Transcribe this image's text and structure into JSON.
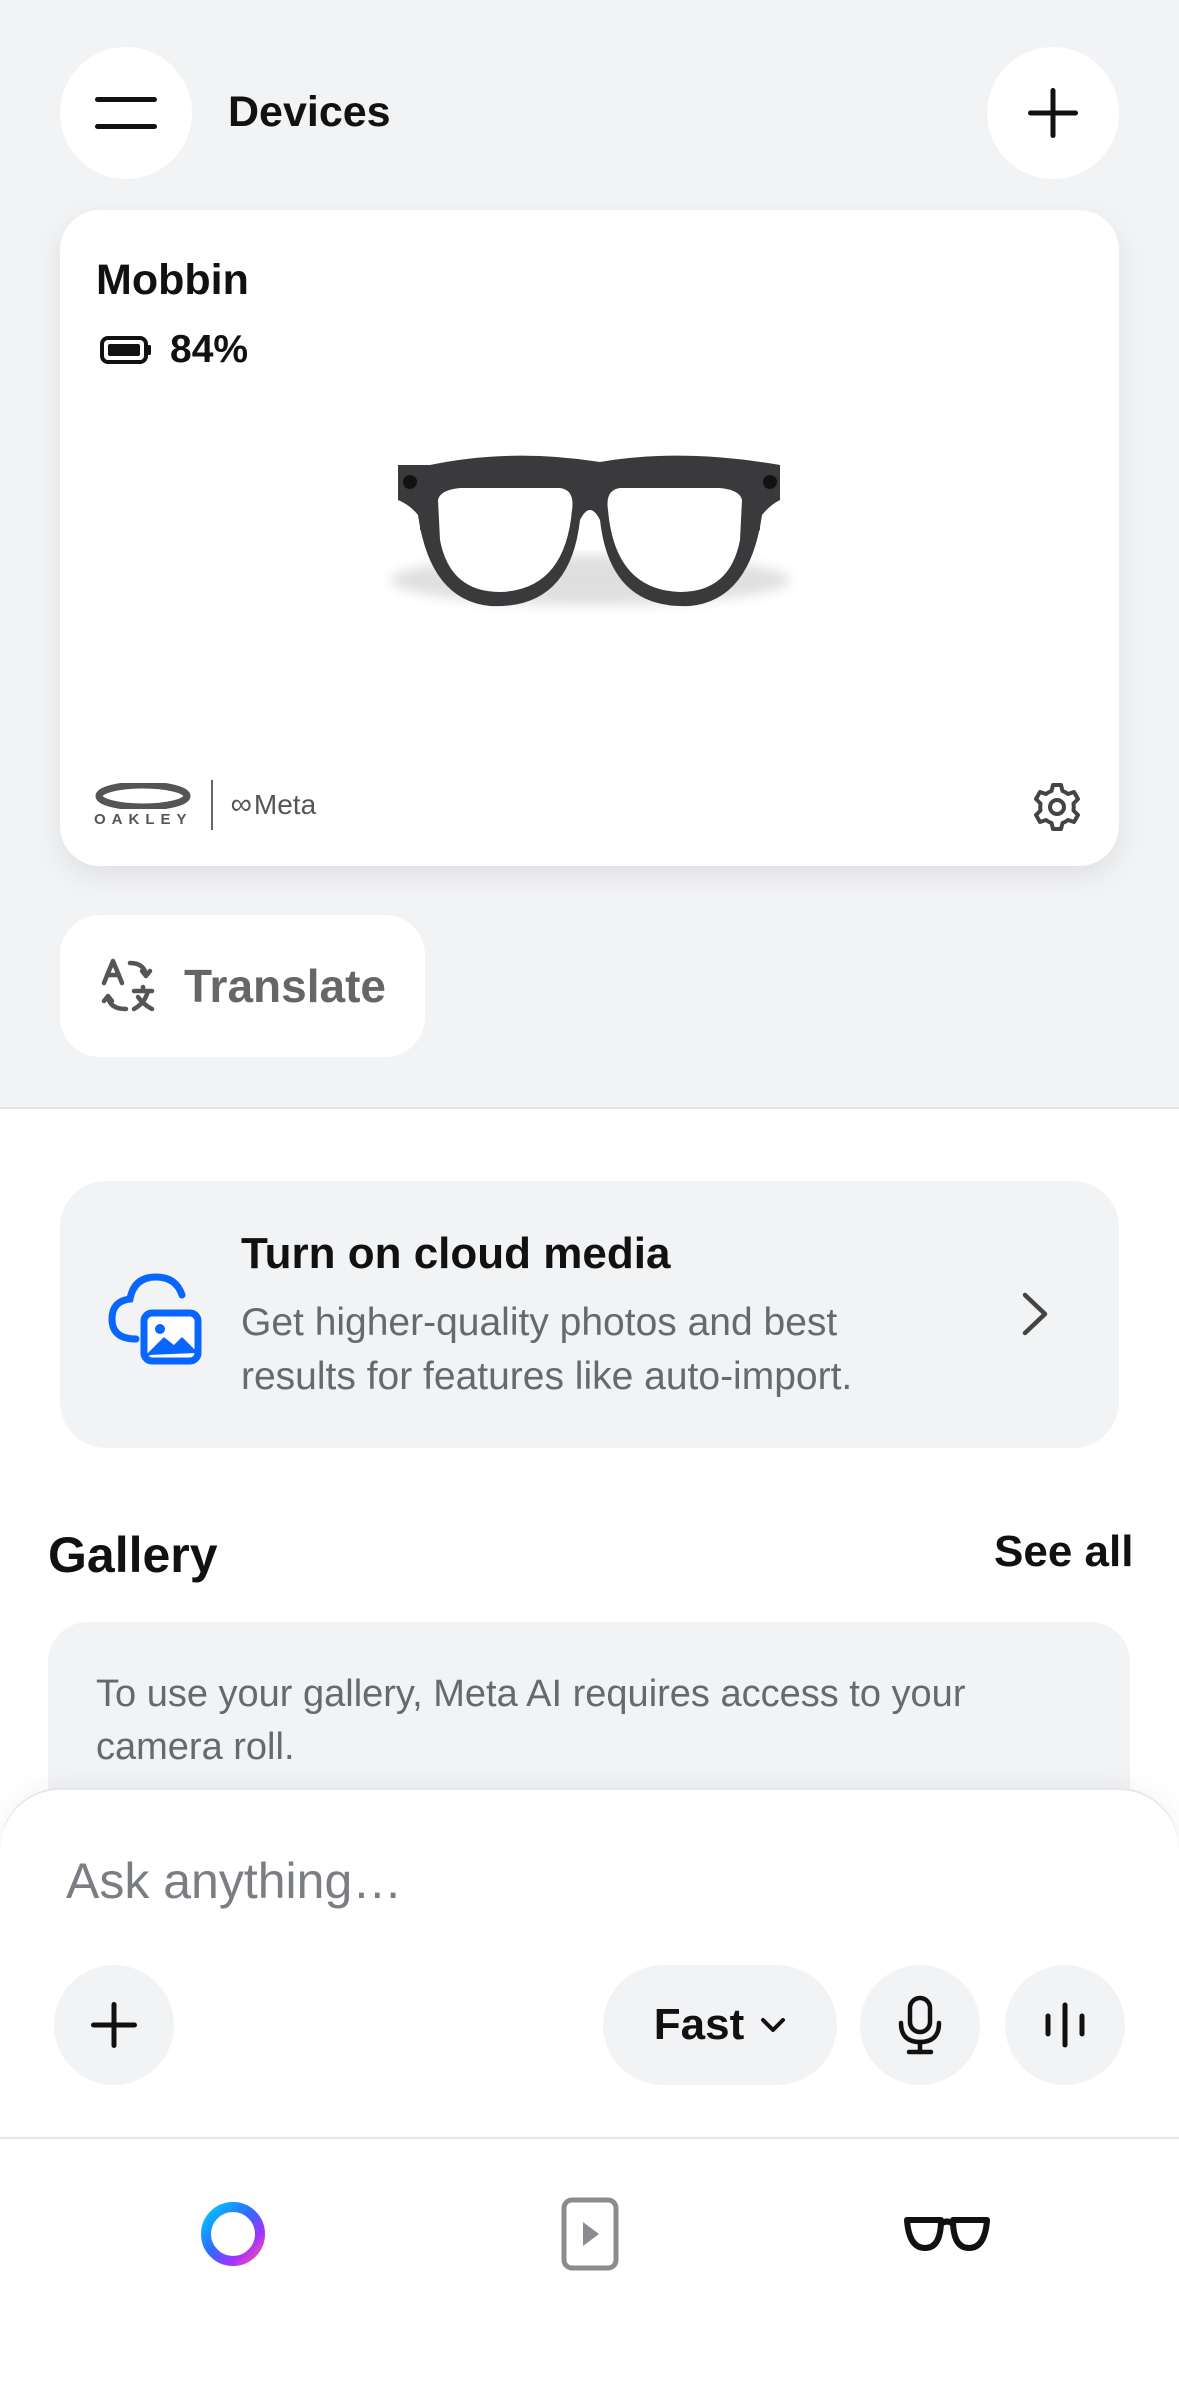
{
  "header": {
    "title": "Devices",
    "menu_icon": "hamburger-menu-icon",
    "add_icon": "plus-icon"
  },
  "device_card": {
    "name": "Mobbin",
    "battery_percent": "84%",
    "battery_icon": "battery-icon",
    "brand_primary": "OAKLEY",
    "brand_secondary": "Meta",
    "settings_icon": "gear-icon"
  },
  "translate": {
    "label": "Translate",
    "icon": "translate-icon"
  },
  "cloud_banner": {
    "title": "Turn on cloud media",
    "description": "Get higher-quality photos and best results for features like auto-import.",
    "icon": "cloud-image-icon",
    "chevron_icon": "chevron-right-icon"
  },
  "gallery": {
    "title": "Gallery",
    "see_all": "See all",
    "notice": "To use your gallery, Meta AI requires access to your camera roll."
  },
  "composer": {
    "placeholder": "Ask anything…",
    "mode": "Fast",
    "attach_icon": "plus-icon",
    "mode_chevron_icon": "chevron-down-icon",
    "mic_icon": "microphone-icon",
    "voice_icon": "voice-waveform-icon"
  },
  "bottom_nav": {
    "items": [
      {
        "icon": "meta-ai-ring-icon"
      },
      {
        "icon": "media-play-icon"
      },
      {
        "icon": "glasses-icon"
      }
    ]
  },
  "colors": {
    "background_top": "#f2f3f5",
    "card": "#ffffff",
    "accent_blue": "#0866ff",
    "text_primary": "#111111",
    "text_secondary": "#66696e"
  }
}
